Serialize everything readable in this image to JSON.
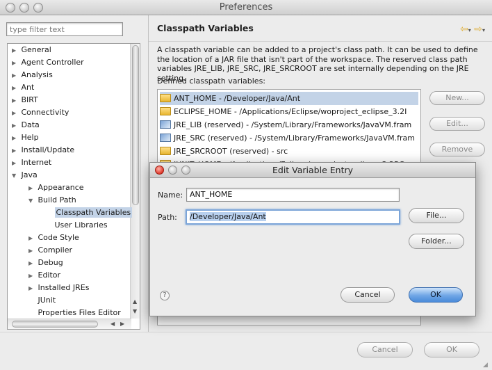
{
  "window": {
    "title": "Preferences"
  },
  "sidebar": {
    "filter_placeholder": "type filter text",
    "items": [
      {
        "label": "General",
        "level": 0,
        "twisty": "closed"
      },
      {
        "label": "Agent Controller",
        "level": 0,
        "twisty": "closed"
      },
      {
        "label": "Analysis",
        "level": 0,
        "twisty": "closed"
      },
      {
        "label": "Ant",
        "level": 0,
        "twisty": "closed"
      },
      {
        "label": "BIRT",
        "level": 0,
        "twisty": "closed"
      },
      {
        "label": "Connectivity",
        "level": 0,
        "twisty": "closed"
      },
      {
        "label": "Data",
        "level": 0,
        "twisty": "closed"
      },
      {
        "label": "Help",
        "level": 0,
        "twisty": "closed"
      },
      {
        "label": "Install/Update",
        "level": 0,
        "twisty": "closed"
      },
      {
        "label": "Internet",
        "level": 0,
        "twisty": "closed"
      },
      {
        "label": "Java",
        "level": 0,
        "twisty": "open"
      },
      {
        "label": "Appearance",
        "level": 1,
        "twisty": "closed"
      },
      {
        "label": "Build Path",
        "level": 1,
        "twisty": "open"
      },
      {
        "label": "Classpath Variables",
        "level": 2,
        "twisty": "none",
        "selected": true
      },
      {
        "label": "User Libraries",
        "level": 2,
        "twisty": "none"
      },
      {
        "label": "Code Style",
        "level": 1,
        "twisty": "closed"
      },
      {
        "label": "Compiler",
        "level": 1,
        "twisty": "closed"
      },
      {
        "label": "Debug",
        "level": 1,
        "twisty": "closed"
      },
      {
        "label": "Editor",
        "level": 1,
        "twisty": "closed"
      },
      {
        "label": "Installed JREs",
        "level": 1,
        "twisty": "closed"
      },
      {
        "label": "JUnit",
        "level": 1,
        "twisty": "none"
      },
      {
        "label": "Properties Files Editor",
        "level": 1,
        "twisty": "none"
      }
    ]
  },
  "page": {
    "title": "Classpath Variables",
    "description": "A classpath variable can be added to a project's class path. It can be used to define the location of a JAR file that isn't part of the workspace. The reserved class path variables JRE_LIB, JRE_SRC, JRE_SRCROOT are set internally depending on the JRE setting.",
    "defined_label": "Defined classpath variables:",
    "variables": [
      {
        "text": "ANT_HOME - /Developer/Java/Ant",
        "icon": "folder-icon",
        "selected": true
      },
      {
        "text": "ECLIPSE_HOME - /Applications/Eclipse/woproject_eclipse_3.2I",
        "icon": "folder-icon"
      },
      {
        "text": "JRE_LIB (reserved) - /System/Library/Frameworks/JavaVM.fram",
        "icon": "jar-icon"
      },
      {
        "text": "JRE_SRC (reserved) - /System/Library/Frameworks/JavaVM.fram",
        "icon": "jar-icon"
      },
      {
        "text": "JRE_SRCROOT (reserved) - src",
        "icon": "folder-icon"
      },
      {
        "text": "JUNIT_HOME - /Applications/Eclipse/woproject_eclipse_3.2RC",
        "icon": "folder-icon"
      }
    ],
    "buttons": {
      "new": "New...",
      "edit": "Edit...",
      "remove": "Remove"
    }
  },
  "footer": {
    "cancel": "Cancel",
    "ok": "OK"
  },
  "dialog": {
    "title": "Edit Variable Entry",
    "name_label": "Name:",
    "name_value": "ANT_HOME",
    "path_label": "Path:",
    "path_value": "/Developer/Java/Ant",
    "file_button": "File...",
    "folder_button": "Folder...",
    "cancel_button": "Cancel",
    "ok_button": "OK"
  }
}
